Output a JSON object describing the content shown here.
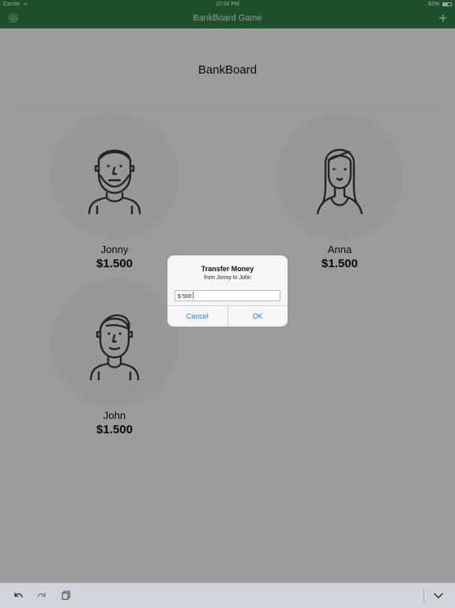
{
  "status_bar": {
    "carrier": "Carrier",
    "time": "10:34 PM",
    "battery": "62%"
  },
  "nav": {
    "title": "BankBoard Game",
    "left_icon": "gear-icon",
    "right_icon": "plus-icon"
  },
  "header": {
    "title": "BankBoard"
  },
  "players": [
    {
      "name": "Jonny",
      "amount": "$1.500",
      "avatar": "bearded-man-icon"
    },
    {
      "name": "Anna",
      "amount": "$1.500",
      "avatar": "woman-icon"
    },
    {
      "name": "John",
      "amount": "$1.500",
      "avatar": "man-icon"
    }
  ],
  "alert": {
    "title": "Transfer Money",
    "message": "from Jonny to John",
    "input_value": "$ 500",
    "cancel_label": "Cancel",
    "ok_label": "OK"
  },
  "toolbar": {
    "undo_icon": "undo-icon",
    "redo_icon": "redo-icon",
    "paste_icon": "paste-icon",
    "dismiss_icon": "chevron-down-icon"
  },
  "colors": {
    "nav_green": "#2f7d46",
    "accent_blue": "#2a7bd8"
  }
}
